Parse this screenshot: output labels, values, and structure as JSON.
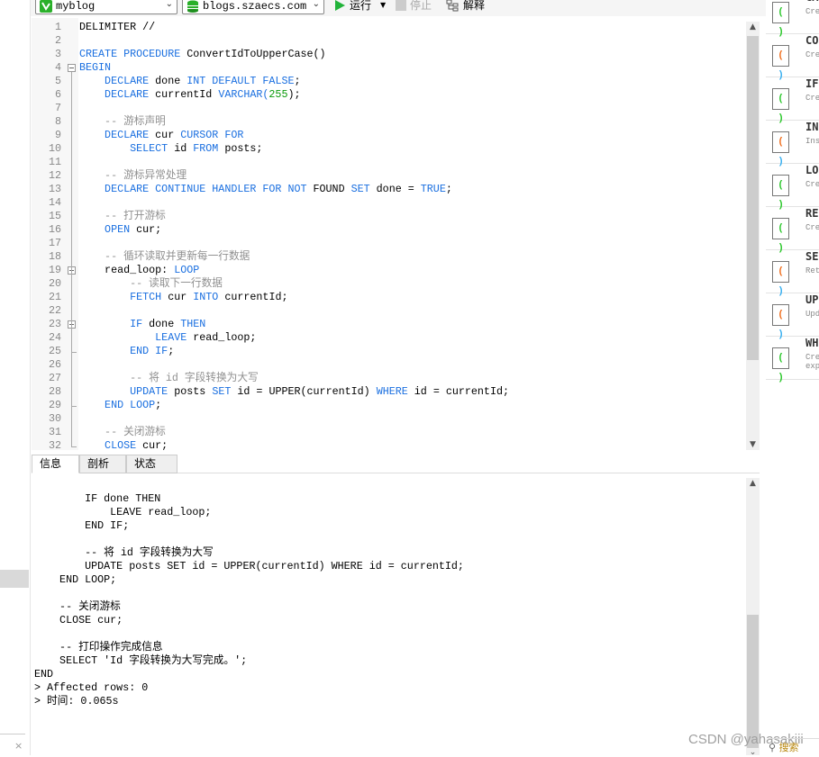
{
  "toolbar": {
    "database": "myblog",
    "connection": "blogs.szaecs.com",
    "run_label": "运行",
    "stop_label": "停止",
    "explain_label": "解释",
    "colors": {
      "run": "#22b33a",
      "db_icon": "#2ab02a"
    }
  },
  "editor": {
    "lines": [
      [
        [
          "DELIMITER //",
          "tx"
        ]
      ],
      [],
      [
        [
          "CREATE PROCEDURE ",
          "kw"
        ],
        [
          "ConvertIdToUpperCase()",
          "tx"
        ]
      ],
      [
        [
          "BEGIN",
          "kw"
        ]
      ],
      [
        [
          "    DECLARE ",
          "kw"
        ],
        [
          "done ",
          "tx"
        ],
        [
          "INT DEFAULT FALSE",
          "kw"
        ],
        [
          ";",
          "tx"
        ]
      ],
      [
        [
          "    DECLARE ",
          "kw"
        ],
        [
          "currentId ",
          "tx"
        ],
        [
          "VARCHAR(",
          "kw"
        ],
        [
          "255",
          "num"
        ],
        [
          ");",
          "tx"
        ]
      ],
      [],
      [
        [
          "    -- 游标声明",
          "cm"
        ]
      ],
      [
        [
          "    DECLARE ",
          "kw"
        ],
        [
          "cur ",
          "tx"
        ],
        [
          "CURSOR FOR",
          "kw"
        ]
      ],
      [
        [
          "        SELECT ",
          "kw"
        ],
        [
          "id ",
          "tx"
        ],
        [
          "FROM ",
          "kw"
        ],
        [
          "posts;",
          "tx"
        ]
      ],
      [],
      [
        [
          "    -- 游标异常处理",
          "cm"
        ]
      ],
      [
        [
          "    DECLARE CONTINUE HANDLER FOR NOT ",
          "kw"
        ],
        [
          "FOUND ",
          "tx"
        ],
        [
          "SET ",
          "kw"
        ],
        [
          "done = ",
          "tx"
        ],
        [
          "TRUE",
          "kw"
        ],
        [
          ";",
          "tx"
        ]
      ],
      [],
      [
        [
          "    -- 打开游标",
          "cm"
        ]
      ],
      [
        [
          "    OPEN ",
          "kw"
        ],
        [
          "cur;",
          "tx"
        ]
      ],
      [],
      [
        [
          "    -- 循环读取并更新每一行数据",
          "cm"
        ]
      ],
      [
        [
          "    read_loop: ",
          "tx"
        ],
        [
          "LOOP",
          "kw"
        ]
      ],
      [
        [
          "        -- 读取下一行数据",
          "cm"
        ]
      ],
      [
        [
          "        FETCH ",
          "kw"
        ],
        [
          "cur ",
          "tx"
        ],
        [
          "INTO ",
          "kw"
        ],
        [
          "currentId;",
          "tx"
        ]
      ],
      [],
      [
        [
          "        IF ",
          "kw"
        ],
        [
          "done ",
          "tx"
        ],
        [
          "THEN",
          "kw"
        ]
      ],
      [
        [
          "            LEAVE ",
          "kw"
        ],
        [
          "read_loop;",
          "tx"
        ]
      ],
      [
        [
          "        END IF",
          "kw"
        ],
        [
          ";",
          "tx"
        ]
      ],
      [],
      [
        [
          "        -- 将 id 字段转换为大写",
          "cm"
        ]
      ],
      [
        [
          "        UPDATE ",
          "kw"
        ],
        [
          "posts ",
          "tx"
        ],
        [
          "SET ",
          "kw"
        ],
        [
          "id = UPPER(currentId) ",
          "tx"
        ],
        [
          "WHERE ",
          "kw"
        ],
        [
          "id = currentId;",
          "tx"
        ]
      ],
      [
        [
          "    END LOOP",
          "kw"
        ],
        [
          ";",
          "tx"
        ]
      ],
      [],
      [
        [
          "    -- 关闭游标",
          "cm"
        ]
      ],
      [
        [
          "    CLOSE ",
          "kw"
        ],
        [
          "cur;",
          "tx"
        ]
      ]
    ],
    "colors": {
      "keyword": "#1a6fe0",
      "comment": "#909090",
      "number": "#0a9a0a"
    }
  },
  "tabs": [
    {
      "label": "信息",
      "active": true
    },
    {
      "label": "剖析"
    },
    {
      "label": "状态"
    }
  ],
  "output": {
    "lines": [
      "        IF done THEN",
      "            LEAVE read_loop;",
      "        END IF;",
      "",
      "        -- 将 id 字段转换为大写",
      "        UPDATE posts SET id = UPPER(currentId) WHERE id = currentId;",
      "    END LOOP;",
      "",
      "    -- 关闭游标",
      "    CLOSE cur;",
      "",
      "    -- 打印操作完成信息",
      "    SELECT 'Id 字段转换为大写完成。';",
      "END",
      "> Affected rows: 0",
      "> 时间: 0.065s"
    ]
  },
  "snippets": [
    {
      "name": "CA",
      "desc": "Cre",
      "icon": "green"
    },
    {
      "name": "CO",
      "desc": "Cre",
      "icon": "multi"
    },
    {
      "name": "IF",
      "desc": "Cre",
      "icon": "green"
    },
    {
      "name": "IN",
      "desc": "Ins",
      "icon": "multi"
    },
    {
      "name": "LO",
      "desc": "Cre",
      "icon": "green"
    },
    {
      "name": "RE",
      "desc": "Cre",
      "icon": "green"
    },
    {
      "name": "SE",
      "desc": "Ret",
      "icon": "multi"
    },
    {
      "name": "UP",
      "desc": "Upd",
      "icon": "multi"
    },
    {
      "name": "WH",
      "desc": "Cre\nexp",
      "icon": "green"
    }
  ],
  "search_label": "搜索",
  "close_glyph": "×",
  "watermark": "CSDN @yahasakiii"
}
